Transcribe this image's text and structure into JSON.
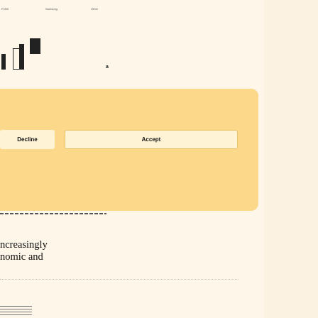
{
  "chart": {
    "legend": [
      {
        "label": "FOMI",
        "color": "#333333"
      },
      {
        "label": "Samsung",
        "color": "#777777"
      },
      {
        "label": "Other",
        "color": "#aaaaaa"
      }
    ],
    "tick_label": "a"
  },
  "consent": {
    "decline_label": "Decline",
    "accept_label": "Accept"
  },
  "article": {
    "lines": [
      "ncreasingly",
      "nomic and"
    ]
  },
  "colors": {
    "background": "#fdf6e9",
    "banner": "#fcd98a",
    "bar_dark": "#222222"
  }
}
